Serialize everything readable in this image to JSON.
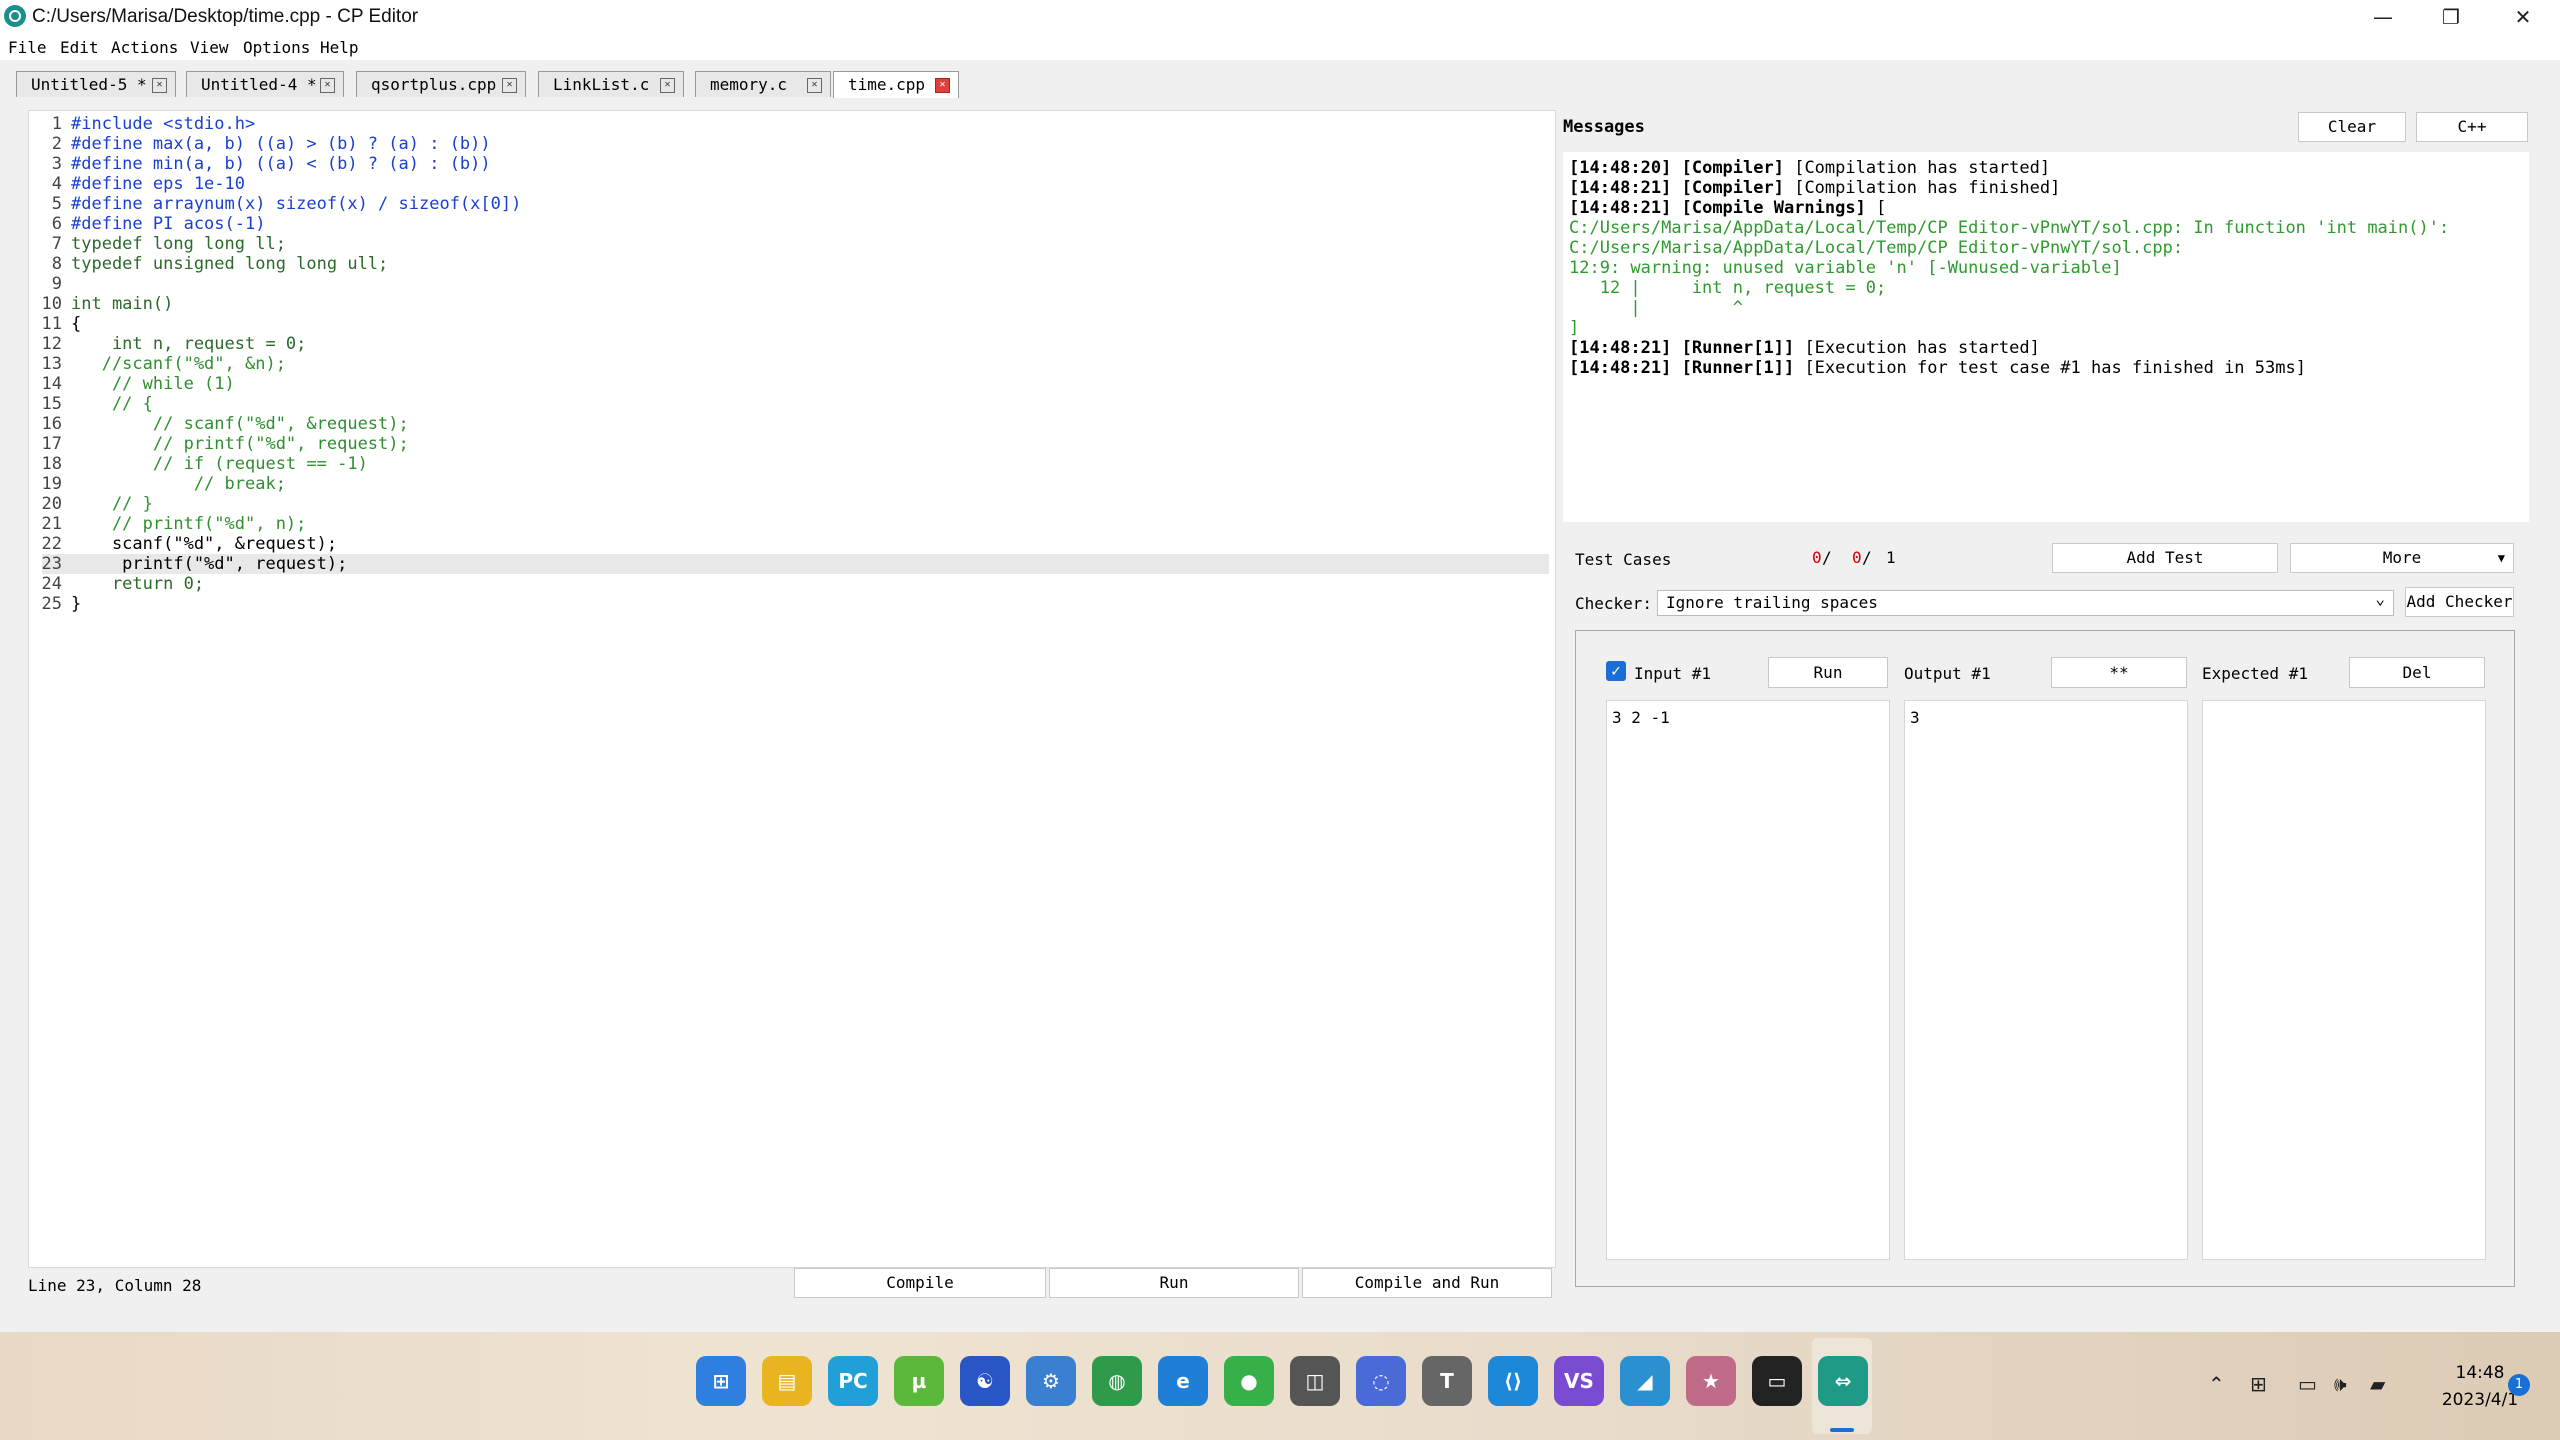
{
  "window": {
    "title": "C:/Users/Marisa/Desktop/time.cpp - CP Editor"
  },
  "menu": [
    "File",
    "Edit",
    "Actions",
    "View",
    "Options",
    "Help"
  ],
  "tabs": [
    {
      "label": "Untitled-5 *"
    },
    {
      "label": "Untitled-4 *"
    },
    {
      "label": "qsortplus.cpp"
    },
    {
      "label": "LinkList.c"
    },
    {
      "label": "memory.c"
    },
    {
      "label": "time.cpp"
    }
  ],
  "editor": {
    "lines": [
      {
        "n": "1",
        "text": "#include <stdio.h>"
      },
      {
        "n": "2",
        "text": "#define max(a, b) ((a) > (b) ? (a) : (b))"
      },
      {
        "n": "3",
        "text": "#define min(a, b) ((a) < (b) ? (a) : (b))"
      },
      {
        "n": "4",
        "text": "#define eps 1e-10"
      },
      {
        "n": "5",
        "text": "#define arraynum(x) sizeof(x) / sizeof(x[0])"
      },
      {
        "n": "6",
        "text": "#define PI acos(-1)"
      },
      {
        "n": "7",
        "text": "typedef long long ll;"
      },
      {
        "n": "8",
        "text": "typedef unsigned long long ull;"
      },
      {
        "n": "9",
        "text": ""
      },
      {
        "n": "10",
        "text": "int main()"
      },
      {
        "n": "11",
        "text": "{"
      },
      {
        "n": "12",
        "text": "    int n, request = 0;"
      },
      {
        "n": "13",
        "text": "   //scanf(\"%d\", &n);"
      },
      {
        "n": "14",
        "text": "    // while (1)"
      },
      {
        "n": "15",
        "text": "    // {"
      },
      {
        "n": "16",
        "text": "        // scanf(\"%d\", &request);"
      },
      {
        "n": "17",
        "text": "        // printf(\"%d\", request);"
      },
      {
        "n": "18",
        "text": "        // if (request == -1)"
      },
      {
        "n": "19",
        "text": "            // break;"
      },
      {
        "n": "20",
        "text": "    // }"
      },
      {
        "n": "21",
        "text": "    // printf(\"%d\", n);"
      },
      {
        "n": "22",
        "text": "    scanf(\"%d\", &request);"
      },
      {
        "n": "23",
        "text": "     printf(\"%d\", request);"
      },
      {
        "n": "24",
        "text": "    return 0;"
      },
      {
        "n": "25",
        "text": "}"
      }
    ]
  },
  "statusbar": {
    "position": "Line 23, Column 28",
    "compile": "Compile",
    "run": "Run",
    "compile_run": "Compile and Run"
  },
  "messages": {
    "title": "Messages",
    "clear": "Clear",
    "lang": "C++",
    "entries": [
      {
        "time": "[14:48:20]",
        "tag": "[Compiler]",
        "text": " [Compilation has started]",
        "style": "normal"
      },
      {
        "time": "[14:48:21]",
        "tag": "[Compiler]",
        "text": " [Compilation has finished]",
        "style": "normal"
      },
      {
        "time": "[14:48:21]",
        "tag": "[Compile Warnings]",
        "text": " [",
        "style": "normal"
      },
      {
        "time": "",
        "tag": "",
        "text": "C:/Users/Marisa/AppData/Local/Temp/CP Editor-vPnwYT/sol.cpp: In function 'int main()':",
        "style": "warn"
      },
      {
        "time": "",
        "tag": "",
        "text": "C:/Users/Marisa/AppData/Local/Temp/CP Editor-vPnwYT/sol.cpp:",
        "style": "warn"
      },
      {
        "time": "",
        "tag": "",
        "text": "12:9: warning: unused variable 'n' [-Wunused-variable]",
        "style": "warn"
      },
      {
        "time": "",
        "tag": "",
        "text": "   12 |     int n, request = 0;",
        "style": "warn"
      },
      {
        "time": "",
        "tag": "",
        "text": "      |         ^",
        "style": "warn"
      },
      {
        "time": "",
        "tag": "",
        "text": "]",
        "style": "warn"
      },
      {
        "time": "[14:48:21]",
        "tag": "[Runner[1]]",
        "text": " [Execution has started]",
        "style": "normal"
      },
      {
        "time": "[14:48:21]",
        "tag": "[Runner[1]]",
        "text": " [Execution for test case #1 has finished in 53ms]",
        "style": "normal"
      }
    ]
  },
  "tests": {
    "label": "Test Cases",
    "passed": "0",
    "sep1": " / ",
    "failed": "0",
    "sep2": " / ",
    "total": "1",
    "add_test": "Add Test",
    "more": "More",
    "checker_label": "Checker:",
    "checker_value": "Ignore trailing spaces",
    "add_checker": "Add Checker",
    "input_label": "Input #1",
    "run": "Run",
    "output_label": "Output #1",
    "diff": "**",
    "expected_label": "Expected #1",
    "del": "Del",
    "input_value": "3 2 -1",
    "output_value": "3",
    "expected_value": ""
  },
  "taskbar": {
    "time": "14:48",
    "date": "2023/4/1",
    "notifications": "1",
    "apps": [
      "start-icon",
      "file-explorer-icon",
      "pycharm-icon",
      "utorrent-icon",
      "taiji-icon",
      "settings-gear-icon",
      "globe-icon",
      "edge-icon",
      "wechat-icon",
      "cat-icon",
      "circle-app-icon",
      "typora-icon",
      "vscode-icon",
      "visual-studio-icon",
      "dolphin-icon",
      "anime-avatar-icon",
      "terminal-icon",
      "cp-editor-icon"
    ]
  }
}
